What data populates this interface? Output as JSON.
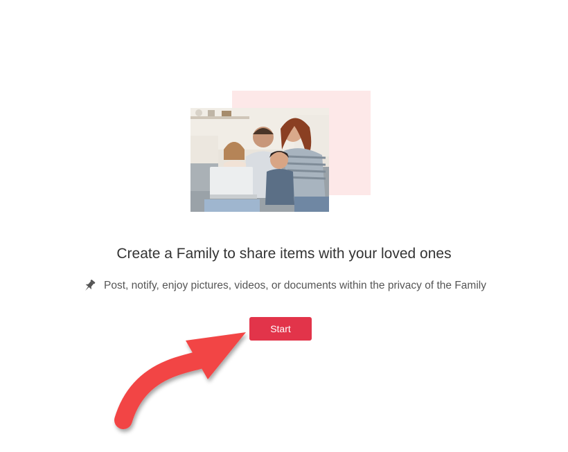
{
  "main": {
    "title": "Create a Family to share items with your loved ones",
    "subtitle": "Post, notify, enjoy pictures, videos, or documents within the privacy of the Family",
    "start_label": "Start"
  },
  "icons": {
    "pin": "pin-icon",
    "arrow": "arrow-annotation"
  },
  "colors": {
    "accent": "#e2344a",
    "arrow": "#f24545",
    "backdrop": "#fde8e8",
    "text": "#333333",
    "muted": "#555555"
  }
}
